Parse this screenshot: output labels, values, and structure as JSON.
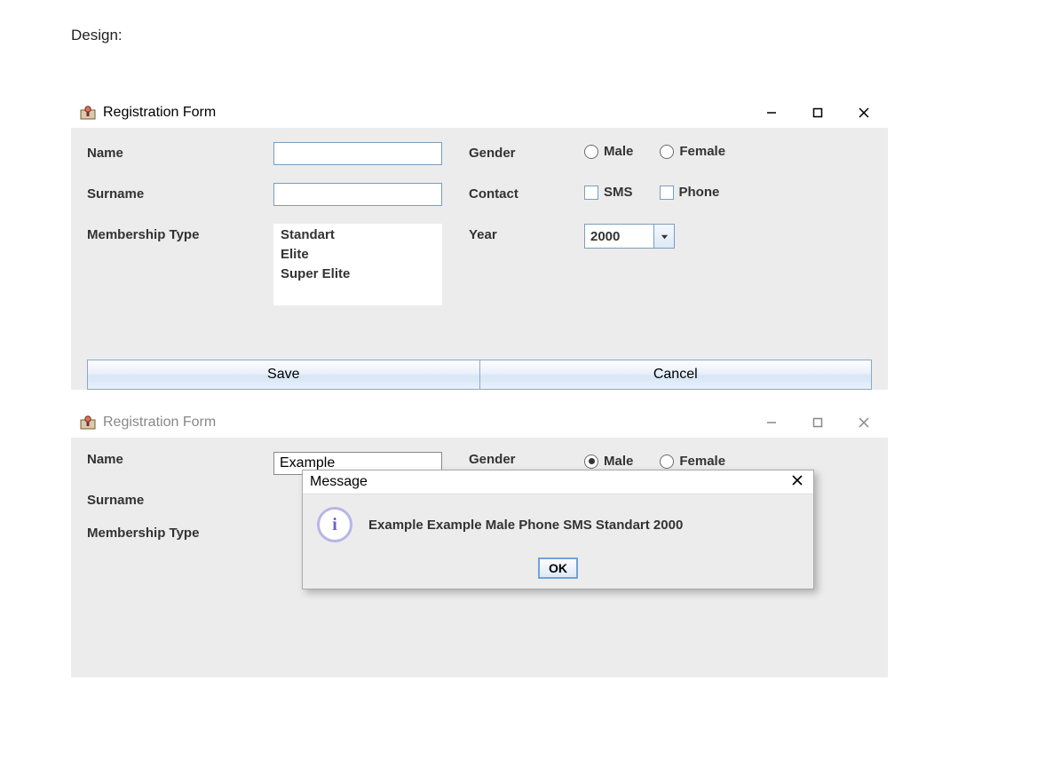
{
  "page_heading": "Design:",
  "window1": {
    "title": "Registration Form",
    "labels": {
      "name": "Name",
      "surname": "Surname",
      "membership": "Membership Type",
      "gender": "Gender",
      "contact": "Contact",
      "year": "Year"
    },
    "name_value": "",
    "surname_value": "",
    "membership_options": [
      "Standart",
      "Elite",
      "Super Elite"
    ],
    "gender_options": {
      "male": "Male",
      "female": "Female"
    },
    "gender_selected": "",
    "contact_options": {
      "sms": "SMS",
      "phone": "Phone"
    },
    "year_value": "2000",
    "buttons": {
      "save": "Save",
      "cancel": "Cancel"
    }
  },
  "window2": {
    "title": "Registration Form",
    "labels": {
      "name": "Name",
      "surname": "Surname",
      "membership": "Membership Type",
      "gender": "Gender"
    },
    "name_value": "Example",
    "gender_options": {
      "male": "Male",
      "female": "Female"
    },
    "gender_selected": "male",
    "dialog": {
      "title": "Message",
      "text": "Example Example Male Phone SMS Standart 2000",
      "ok": "OK"
    }
  }
}
